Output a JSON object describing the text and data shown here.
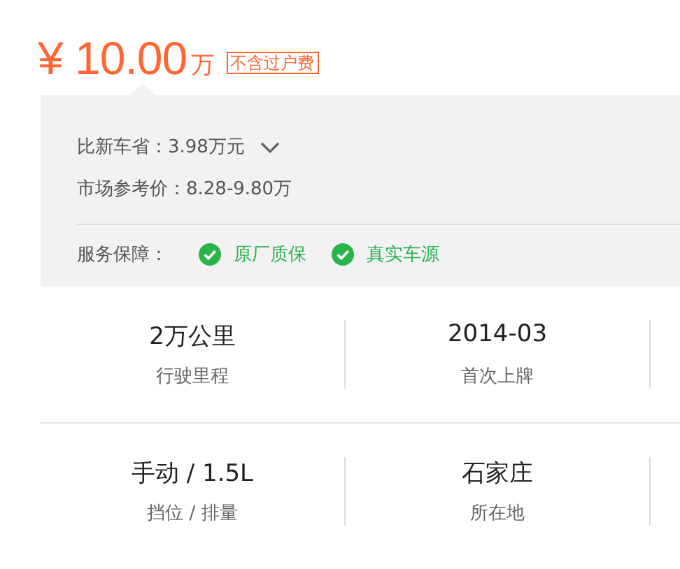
{
  "price": {
    "currency": "¥",
    "amount": "10.00",
    "unit": "万",
    "tag": "不含过户费"
  },
  "savings": {
    "label": "比新车省：",
    "value": "3.98万元",
    "expanded": false
  },
  "market_price": {
    "label": "市场参考价：",
    "value": "8.28-9.80万"
  },
  "service": {
    "label": "服务保障：",
    "items": [
      "原厂质保",
      "真实车源"
    ]
  },
  "stats": [
    [
      {
        "value": "2万公里",
        "label": "行驶里程"
      },
      {
        "value": "2014-03",
        "label": "首次上牌"
      }
    ],
    [
      {
        "value": "手动 / 1.5L",
        "label": "挡位 / 排量"
      },
      {
        "value": "石家庄",
        "label": "所在地"
      }
    ]
  ]
}
